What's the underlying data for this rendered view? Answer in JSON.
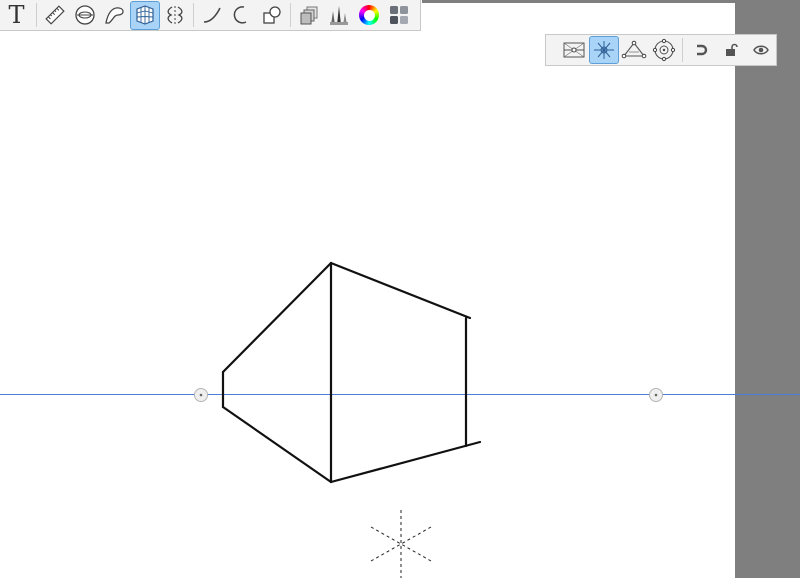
{
  "toolbar": {
    "text_tool_glyph": "T",
    "tools": [
      {
        "name": "text-tool",
        "icon": "text-icon"
      },
      {
        "name": "ruler-tool",
        "icon": "ruler-icon"
      },
      {
        "name": "ellipse-guide-tool",
        "icon": "ellipse-guide-icon"
      },
      {
        "name": "french-curve-tool",
        "icon": "french-curve-icon"
      },
      {
        "name": "perspective-guide-tool",
        "icon": "perspective-grid-icon",
        "active": true
      },
      {
        "name": "symmetry-tool",
        "icon": "symmetry-icon"
      },
      {
        "name": "steady-stroke-tool",
        "icon": "steady-stroke-icon"
      },
      {
        "name": "predictive-stroke-tool",
        "icon": "predictive-stroke-icon"
      },
      {
        "name": "shape-tool",
        "icon": "shape-icon"
      },
      {
        "name": "layers-tool",
        "icon": "layers-icon"
      },
      {
        "name": "brush-library-tool",
        "icon": "brushes-icon"
      },
      {
        "name": "color-wheel-tool",
        "icon": "color-wheel-icon"
      },
      {
        "name": "copic-colors-tool",
        "icon": "swatches-icon"
      }
    ]
  },
  "perspective_toolbar": {
    "modes": [
      {
        "name": "one-point",
        "icon": "one-point-perspective-icon"
      },
      {
        "name": "two-point",
        "icon": "two-point-perspective-icon",
        "active": true
      },
      {
        "name": "three-point",
        "icon": "three-point-perspective-icon"
      },
      {
        "name": "fisheye",
        "icon": "fisheye-perspective-icon"
      }
    ],
    "actions": [
      {
        "name": "snap",
        "icon": "magnet-icon"
      },
      {
        "name": "lock",
        "icon": "lock-icon"
      },
      {
        "name": "visibility",
        "icon": "eye-icon"
      }
    ]
  },
  "colors": {
    "accent": "#a9d4f7",
    "accent_border": "#5c9fd8",
    "horizon_line": "#4a7fd8",
    "background_gray": "#7f7f7f",
    "stroke": "#111111"
  }
}
